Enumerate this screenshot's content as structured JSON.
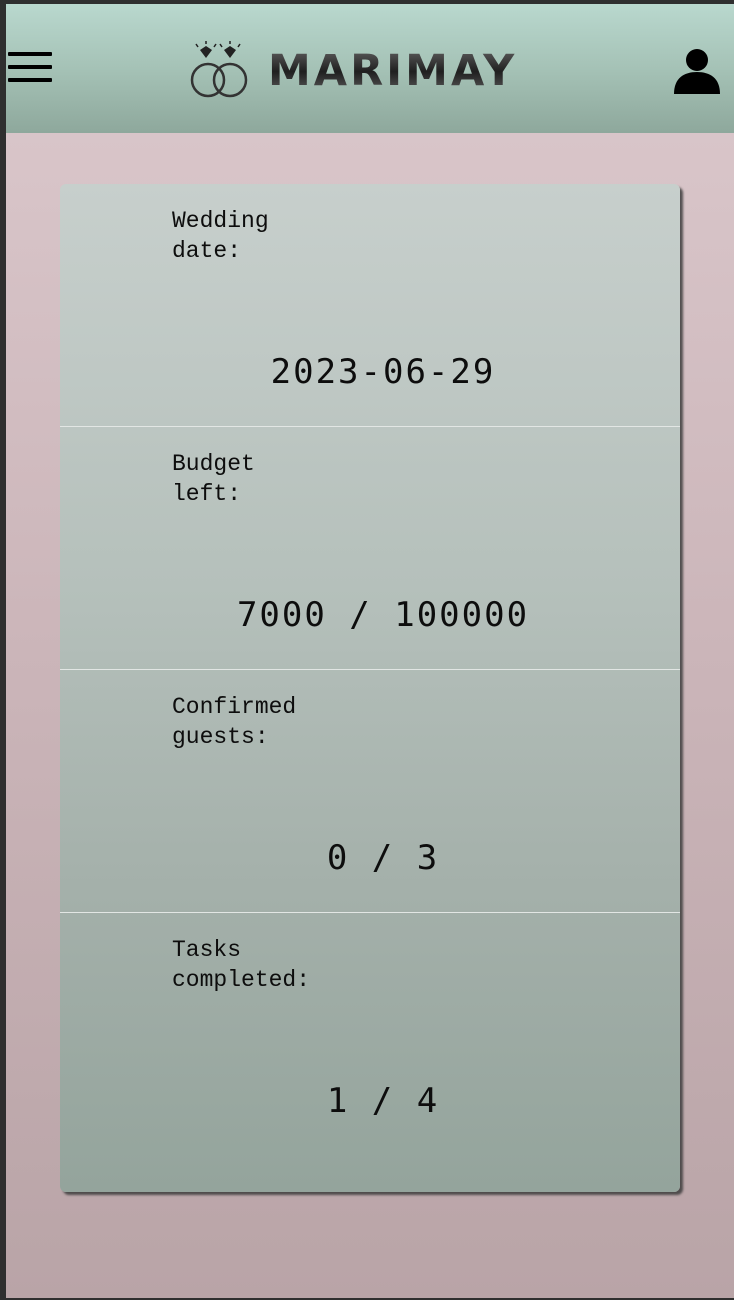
{
  "header": {
    "menu_icon": "hamburger-menu-icon",
    "logo_text": "MARIMAY",
    "logo_icon": "wedding-rings-icon",
    "user_icon": "user-profile-icon"
  },
  "stats": [
    {
      "label": "Wedding\ndate:",
      "value": "2023-06-29"
    },
    {
      "label": "Budget\nleft:",
      "value": "7000 / 100000"
    },
    {
      "label": "Confirmed\nguests:",
      "value": "0 / 3"
    },
    {
      "label": "Tasks\ncompleted:",
      "value": "1 / 4"
    }
  ],
  "colors": {
    "header_top": "#b9d8ce",
    "header_bottom": "#8ea89c",
    "background_top": "#dcc9cd",
    "background_bottom": "#b9a4a7",
    "card_top": "#c7cfcc",
    "card_bottom": "#94a49c"
  }
}
